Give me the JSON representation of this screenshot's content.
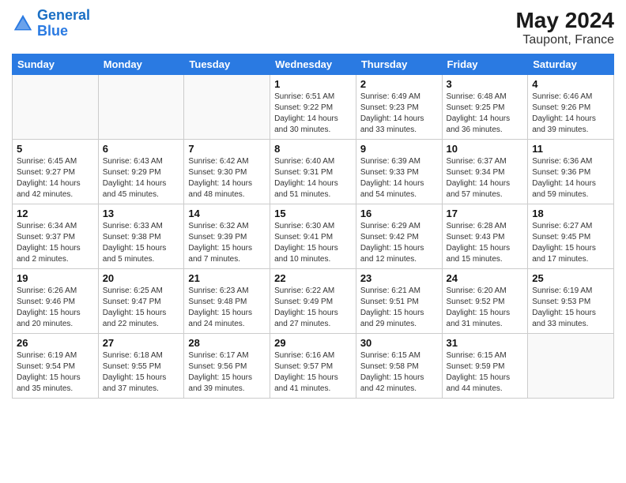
{
  "logo": {
    "line1": "General",
    "line2": "Blue"
  },
  "title": "May 2024",
  "location": "Taupont, France",
  "days_header": [
    "Sunday",
    "Monday",
    "Tuesday",
    "Wednesday",
    "Thursday",
    "Friday",
    "Saturday"
  ],
  "weeks": [
    [
      {
        "day": "",
        "info": ""
      },
      {
        "day": "",
        "info": ""
      },
      {
        "day": "",
        "info": ""
      },
      {
        "day": "1",
        "info": "Sunrise: 6:51 AM\nSunset: 9:22 PM\nDaylight: 14 hours\nand 30 minutes."
      },
      {
        "day": "2",
        "info": "Sunrise: 6:49 AM\nSunset: 9:23 PM\nDaylight: 14 hours\nand 33 minutes."
      },
      {
        "day": "3",
        "info": "Sunrise: 6:48 AM\nSunset: 9:25 PM\nDaylight: 14 hours\nand 36 minutes."
      },
      {
        "day": "4",
        "info": "Sunrise: 6:46 AM\nSunset: 9:26 PM\nDaylight: 14 hours\nand 39 minutes."
      }
    ],
    [
      {
        "day": "5",
        "info": "Sunrise: 6:45 AM\nSunset: 9:27 PM\nDaylight: 14 hours\nand 42 minutes."
      },
      {
        "day": "6",
        "info": "Sunrise: 6:43 AM\nSunset: 9:29 PM\nDaylight: 14 hours\nand 45 minutes."
      },
      {
        "day": "7",
        "info": "Sunrise: 6:42 AM\nSunset: 9:30 PM\nDaylight: 14 hours\nand 48 minutes."
      },
      {
        "day": "8",
        "info": "Sunrise: 6:40 AM\nSunset: 9:31 PM\nDaylight: 14 hours\nand 51 minutes."
      },
      {
        "day": "9",
        "info": "Sunrise: 6:39 AM\nSunset: 9:33 PM\nDaylight: 14 hours\nand 54 minutes."
      },
      {
        "day": "10",
        "info": "Sunrise: 6:37 AM\nSunset: 9:34 PM\nDaylight: 14 hours\nand 57 minutes."
      },
      {
        "day": "11",
        "info": "Sunrise: 6:36 AM\nSunset: 9:36 PM\nDaylight: 14 hours\nand 59 minutes."
      }
    ],
    [
      {
        "day": "12",
        "info": "Sunrise: 6:34 AM\nSunset: 9:37 PM\nDaylight: 15 hours\nand 2 minutes."
      },
      {
        "day": "13",
        "info": "Sunrise: 6:33 AM\nSunset: 9:38 PM\nDaylight: 15 hours\nand 5 minutes."
      },
      {
        "day": "14",
        "info": "Sunrise: 6:32 AM\nSunset: 9:39 PM\nDaylight: 15 hours\nand 7 minutes."
      },
      {
        "day": "15",
        "info": "Sunrise: 6:30 AM\nSunset: 9:41 PM\nDaylight: 15 hours\nand 10 minutes."
      },
      {
        "day": "16",
        "info": "Sunrise: 6:29 AM\nSunset: 9:42 PM\nDaylight: 15 hours\nand 12 minutes."
      },
      {
        "day": "17",
        "info": "Sunrise: 6:28 AM\nSunset: 9:43 PM\nDaylight: 15 hours\nand 15 minutes."
      },
      {
        "day": "18",
        "info": "Sunrise: 6:27 AM\nSunset: 9:45 PM\nDaylight: 15 hours\nand 17 minutes."
      }
    ],
    [
      {
        "day": "19",
        "info": "Sunrise: 6:26 AM\nSunset: 9:46 PM\nDaylight: 15 hours\nand 20 minutes."
      },
      {
        "day": "20",
        "info": "Sunrise: 6:25 AM\nSunset: 9:47 PM\nDaylight: 15 hours\nand 22 minutes."
      },
      {
        "day": "21",
        "info": "Sunrise: 6:23 AM\nSunset: 9:48 PM\nDaylight: 15 hours\nand 24 minutes."
      },
      {
        "day": "22",
        "info": "Sunrise: 6:22 AM\nSunset: 9:49 PM\nDaylight: 15 hours\nand 27 minutes."
      },
      {
        "day": "23",
        "info": "Sunrise: 6:21 AM\nSunset: 9:51 PM\nDaylight: 15 hours\nand 29 minutes."
      },
      {
        "day": "24",
        "info": "Sunrise: 6:20 AM\nSunset: 9:52 PM\nDaylight: 15 hours\nand 31 minutes."
      },
      {
        "day": "25",
        "info": "Sunrise: 6:19 AM\nSunset: 9:53 PM\nDaylight: 15 hours\nand 33 minutes."
      }
    ],
    [
      {
        "day": "26",
        "info": "Sunrise: 6:19 AM\nSunset: 9:54 PM\nDaylight: 15 hours\nand 35 minutes."
      },
      {
        "day": "27",
        "info": "Sunrise: 6:18 AM\nSunset: 9:55 PM\nDaylight: 15 hours\nand 37 minutes."
      },
      {
        "day": "28",
        "info": "Sunrise: 6:17 AM\nSunset: 9:56 PM\nDaylight: 15 hours\nand 39 minutes."
      },
      {
        "day": "29",
        "info": "Sunrise: 6:16 AM\nSunset: 9:57 PM\nDaylight: 15 hours\nand 41 minutes."
      },
      {
        "day": "30",
        "info": "Sunrise: 6:15 AM\nSunset: 9:58 PM\nDaylight: 15 hours\nand 42 minutes."
      },
      {
        "day": "31",
        "info": "Sunrise: 6:15 AM\nSunset: 9:59 PM\nDaylight: 15 hours\nand 44 minutes."
      },
      {
        "day": "",
        "info": ""
      }
    ]
  ]
}
